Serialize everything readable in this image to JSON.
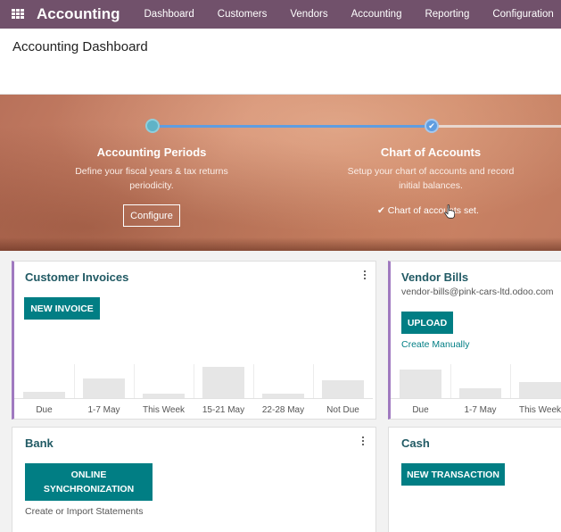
{
  "navbar": {
    "brand": "Accounting",
    "menu": [
      "Dashboard",
      "Customers",
      "Vendors",
      "Accounting",
      "Reporting",
      "Configuration"
    ]
  },
  "page": {
    "title": "Accounting Dashboard"
  },
  "banner": {
    "steps": [
      {
        "title": "Accounting Periods",
        "description": "Define your fiscal years & tax returns periodicity.",
        "button": "Configure"
      },
      {
        "title": "Chart of Accounts",
        "description": "Setup your chart of accounts and record initial balances.",
        "done_note": "Chart of accounts set."
      }
    ]
  },
  "cards": {
    "customer_invoices": {
      "title": "Customer Invoices",
      "button": "NEW INVOICE",
      "chart": {
        "labels": [
          "Due",
          "1-7 May",
          "This Week",
          "15-21 May",
          "22-28 May",
          "Not Due"
        ],
        "values": [
          0.2,
          0.62,
          0.14,
          1.0,
          0.14,
          0.56
        ]
      }
    },
    "vendor_bills": {
      "title": "Vendor Bills",
      "email": "vendor-bills@pink-cars-ltd.odoo.com",
      "button": "UPLOAD",
      "link": "Create Manually",
      "chart": {
        "labels": [
          "Due",
          "1-7 May",
          "This Week"
        ],
        "values": [
          0.9,
          0.31,
          0.52
        ]
      }
    },
    "bank": {
      "title": "Bank",
      "button": "ONLINE SYNCHRONIZATION",
      "note": "Create or Import Statements"
    },
    "cash": {
      "title": "Cash",
      "button": "NEW TRANSACTION"
    }
  },
  "colors": {
    "navbar": "#71516b",
    "primary": "#017e84",
    "accent": "#a07ac0",
    "title": "#215a64"
  }
}
